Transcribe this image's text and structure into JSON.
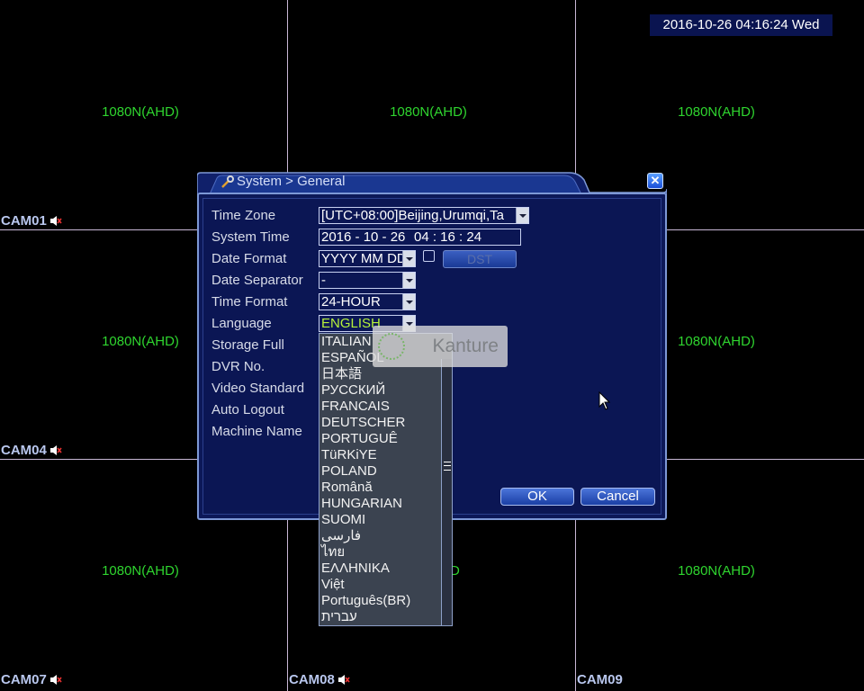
{
  "clock": "2016-10-26 04:16:24 Wed",
  "cameras": [
    {
      "label": "CAM01",
      "res": "1080N(AHD)"
    },
    {
      "label": "",
      "res": "1080N(AHD)"
    },
    {
      "label": "",
      "res": "1080N(AHD)"
    },
    {
      "label": "CAM04",
      "res": "1080N(AHD)"
    },
    {
      "label": "",
      "res": ""
    },
    {
      "label": "",
      "res": "1080N(AHD)"
    },
    {
      "label": "CAM07",
      "res": "1080N(AHD)"
    },
    {
      "label": "CAM08",
      "res": "D"
    },
    {
      "label": "CAM09",
      "res": "1080N(AHD)"
    }
  ],
  "dialog": {
    "title": "System > General",
    "close_icon": "close-icon",
    "labels": {
      "time_zone": "Time Zone",
      "system_time": "System Time",
      "date_format": "Date Format",
      "date_separator": "Date Separator",
      "time_format": "Time Format",
      "language": "Language",
      "storage_full": "Storage Full",
      "dvr_no": "DVR No.",
      "video_standard": "Video Standard",
      "auto_logout": "Auto Logout",
      "machine_name": "Machine Name"
    },
    "values": {
      "time_zone": "[UTC+08:00]Beijing,Urumqi,Ta",
      "system_time_date": "2016 - 10 - 26",
      "system_time_time": "04 : 16 : 24",
      "date_format": "YYYY MM DD",
      "date_separator": "-",
      "time_format": "24-HOUR",
      "language": "ENGLISH"
    },
    "dst_label": "DST",
    "ok_label": "OK",
    "cancel_label": "Cancel"
  },
  "language_options": [
    "ITALIAN",
    "ESPAÑOL",
    "日本語",
    "РУССКИЙ",
    "FRANCAIS",
    "DEUTSCHER",
    "PORTUGUÊ",
    "TüRKiYE",
    "POLAND",
    "Română",
    "HUNGARIAN",
    "SUOMI",
    "فارسی",
    "ไทย",
    "ΕΛΛΗΝΙΚΑ",
    "Việt",
    "Português(BR)",
    "עברית"
  ],
  "watermark": "Kanture",
  "colors": {
    "accent": "#0c1858",
    "resolution_text": "#2fd52f",
    "selected": "#b7f23a"
  }
}
